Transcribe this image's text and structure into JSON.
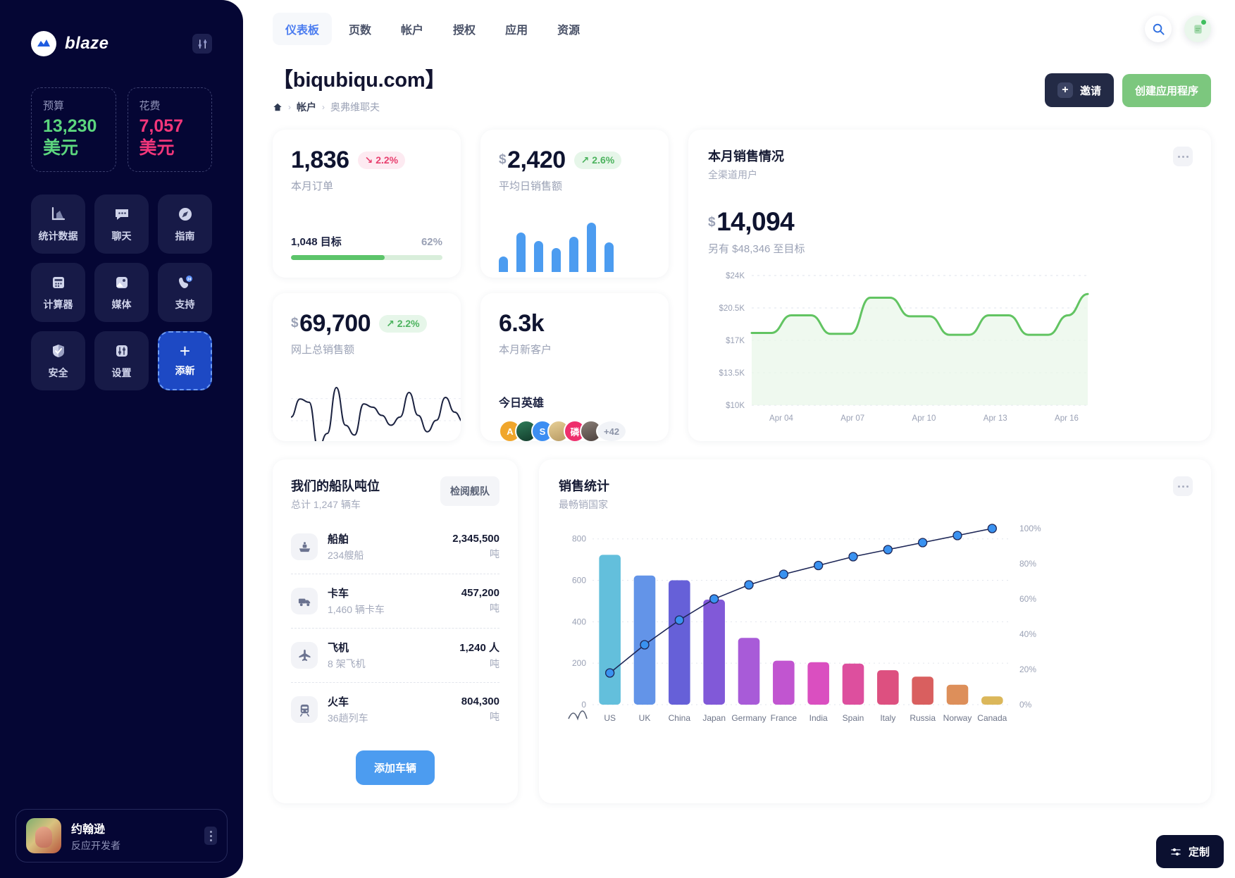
{
  "sidebar": {
    "brand": "blaze",
    "tool_icon": "sliders-icon",
    "stats": [
      {
        "label": "预算",
        "value": "13,230 美元",
        "color": "#5cd67e"
      },
      {
        "label": "花费",
        "value": "7,057 美元",
        "color": "#f2367a"
      }
    ],
    "tiles": [
      {
        "label": "统计数据",
        "icon": "chart-icon"
      },
      {
        "label": "聊天",
        "icon": "chat-icon"
      },
      {
        "label": "指南",
        "icon": "compass-icon"
      },
      {
        "label": "计算器",
        "icon": "calculator-icon"
      },
      {
        "label": "媒体",
        "icon": "image-icon"
      },
      {
        "label": "支持",
        "icon": "phone-24-icon"
      },
      {
        "label": "安全",
        "icon": "shield-icon"
      },
      {
        "label": "设置",
        "icon": "settings-icon"
      },
      {
        "label": "添新",
        "icon": "plus-icon",
        "plus": "+"
      }
    ],
    "profile": {
      "name": "约翰逊",
      "role": "反应开发者"
    }
  },
  "topnav": {
    "tabs": [
      "仪表板",
      "页数",
      "帐户",
      "授权",
      "应用",
      "资源"
    ],
    "active_index": 0,
    "search_icon": "search-icon",
    "notes_icon": "note-icon"
  },
  "header": {
    "title": "【biqubiqu.com】",
    "breadcrumb": [
      "帐户",
      "奥弗维耶夫"
    ],
    "invite_label": "邀请",
    "invite_plus": "+",
    "create_label": "创建应用程序"
  },
  "kpi": {
    "orders": {
      "value": "1,836",
      "delta": "2.2%",
      "delta_dir": "down",
      "label": "本月订单",
      "goal_label": "1,048 目标",
      "goal_pct_text": "62%",
      "goal_pct": 62
    },
    "avg_daily": {
      "currency": "$",
      "value": "2,420",
      "delta": "2.6%",
      "delta_dir": "up",
      "label": "平均日销售额"
    },
    "online_total": {
      "currency": "$",
      "value": "69,700",
      "delta": "2.2%",
      "delta_dir": "up",
      "label": "网上总销售额"
    },
    "new_customers": {
      "value": "6.3k",
      "label": "本月新客户",
      "hero_title": "今日英雄",
      "avatars": [
        "A",
        "",
        "S",
        "",
        "磷",
        ""
      ],
      "more": "+42"
    }
  },
  "sales_month": {
    "title": "本月销售情况",
    "subtitle": "全渠道用户",
    "currency": "$",
    "value": "14,094",
    "note": "另有 $48,346 至目标",
    "menu_icon": "more-icon"
  },
  "fleet": {
    "title": "我们的船队吨位",
    "subtitle": "总计 1,247 辆车",
    "review_label": "检阅舰队",
    "add_label": "添加车辆",
    "rows": [
      {
        "name": "船舶",
        "meta": "234艘船",
        "value": "2,345,500",
        "unit": "吨",
        "icon": "ship-icon"
      },
      {
        "name": "卡车",
        "meta": "1,460 辆卡车",
        "value": "457,200",
        "unit": "吨",
        "icon": "truck-icon"
      },
      {
        "name": "飞机",
        "meta": "8 架飞机",
        "value": "1,240 人",
        "unit": "吨",
        "icon": "plane-icon"
      },
      {
        "name": "火车",
        "meta": "36趟列车",
        "value": "804,300",
        "unit": "吨",
        "icon": "train-icon"
      }
    ]
  },
  "sales_stats": {
    "title": "销售统计",
    "subtitle": "最畅销国家",
    "menu_icon": "more-icon",
    "legend_icon": "bell-curve-icon"
  },
  "customize": {
    "label": "定制",
    "icon": "sliders-icon"
  },
  "chart_data": [
    {
      "type": "area",
      "title": "本月销售情况",
      "x": [
        "Apr 01",
        "Apr 02",
        "Apr 03",
        "Apr 04",
        "Apr 05",
        "Apr 06",
        "Apr 07",
        "Apr 08",
        "Apr 09",
        "Apr 10",
        "Apr 11",
        "Apr 12",
        "Apr 13",
        "Apr 14",
        "Apr 15",
        "Apr 16",
        "Apr 17",
        "Apr 18"
      ],
      "values": [
        17800,
        17800,
        19700,
        19700,
        17700,
        17700,
        21600,
        21600,
        19600,
        19600,
        17600,
        17600,
        19700,
        19700,
        17600,
        17600,
        19700,
        22000
      ],
      "tick_labels": [
        "Apr 04",
        "Apr 07",
        "Apr 10",
        "Apr 13",
        "Apr 16"
      ],
      "ylabel_ticks": [
        "$24K",
        "$20.5K",
        "$17K",
        "$13.5K",
        "$10K"
      ],
      "ylim": [
        10000,
        24000
      ],
      "grid": true,
      "line_color": "#62c462",
      "fill_color": "#eaf7ea"
    },
    {
      "type": "bar",
      "title": "销售统计",
      "subtitle": "最畅销国家",
      "categories": [
        "US",
        "UK",
        "China",
        "Japan",
        "Germany",
        "France",
        "India",
        "Spain",
        "Italy",
        "Russia",
        "Norway",
        "Canada"
      ],
      "values": [
        723,
        623,
        600,
        507,
        322,
        212,
        205,
        198,
        166,
        135,
        96,
        40
      ],
      "ylabel_ticks": [
        "0",
        "200",
        "400",
        "600",
        "800"
      ],
      "ylim": [
        0,
        850
      ],
      "cumulative_label": "cumulative %",
      "cumulative": [
        18,
        34,
        48,
        60,
        68,
        74,
        79,
        84,
        88,
        92,
        96,
        100
      ],
      "y2_ticks": [
        "0%",
        "20%",
        "40%",
        "60%",
        "80%",
        "100%"
      ],
      "y2lim": [
        0,
        100
      ],
      "bar_colors": [
        "#63bfdc",
        "#6394e8",
        "#6660d8",
        "#8159d8",
        "#a85bd8",
        "#c155d0",
        "#da4fc0",
        "#dd4f9e",
        "#dd5080",
        "#d95f5f",
        "#dd8f5a",
        "#dbb75a"
      ],
      "line_color": "#1d2656",
      "marker_color": "#3a92f0",
      "grid": true
    },
    {
      "type": "bar",
      "title": "平均日销售额 sparkline",
      "categories": [
        "1",
        "2",
        "3",
        "4",
        "5",
        "6",
        "7"
      ],
      "values": [
        22,
        56,
        44,
        34,
        50,
        70,
        42
      ],
      "color": "#4c9cf0"
    },
    {
      "type": "line",
      "title": "网上总销售额 sparkline",
      "values": [
        50,
        72,
        68,
        12,
        30,
        86,
        40,
        28,
        66,
        62,
        52,
        40,
        50,
        80,
        52,
        32,
        46,
        74,
        56,
        44,
        52
      ],
      "color": "#1b2240"
    }
  ]
}
